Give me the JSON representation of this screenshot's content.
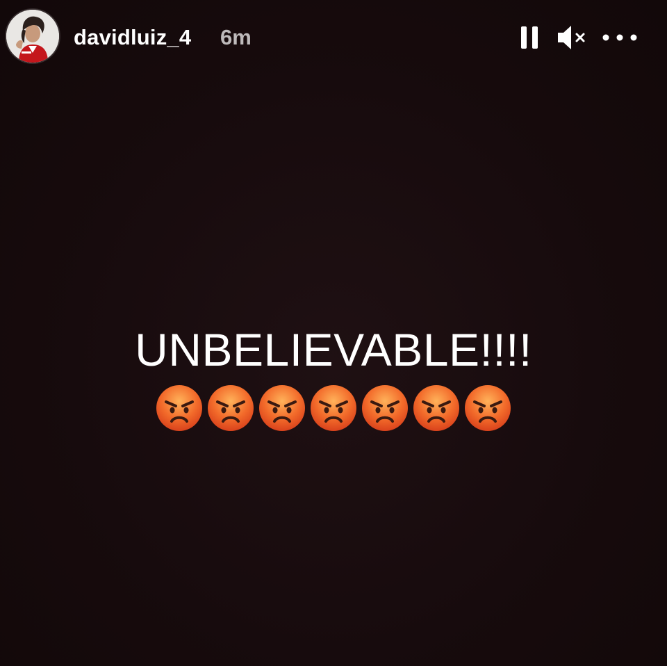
{
  "header": {
    "username": "davidluiz_4",
    "time_ago": "6m",
    "controls": {
      "pause_icon": "pause-icon",
      "mute_icon": "muted-speaker-icon",
      "more_icon": "more-options-icon"
    }
  },
  "story": {
    "text": "UNBELIEVABLE!!!!",
    "emoji": [
      "angry-face",
      "angry-face",
      "angry-face",
      "angry-face",
      "angry-face",
      "angry-face",
      "angry-face"
    ]
  },
  "colors": {
    "background": "#170b0d",
    "text": "#ffffff",
    "emoji_face": "#f26a2a"
  }
}
